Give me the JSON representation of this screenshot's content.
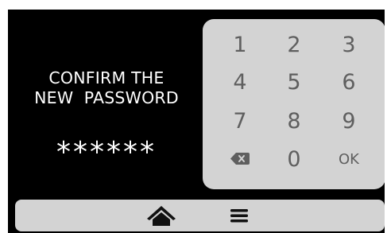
{
  "prompt": {
    "line1": "CONFIRM THE",
    "line2": "NEW  PASSWORD"
  },
  "password_mask": "******",
  "keypad": {
    "keys": [
      "1",
      "2",
      "3",
      "4",
      "5",
      "6",
      "7",
      "8",
      "9",
      "",
      "0",
      "OK"
    ],
    "backspace_icon": "backspace-icon"
  },
  "nav": {
    "home_icon": "home-icon",
    "menu_icon": "menu-icon"
  },
  "colors": {
    "screen_bg": "#000000",
    "panel_bg": "#d3d3d3",
    "key_text": "#5f5f5f",
    "text": "#ffffff"
  }
}
